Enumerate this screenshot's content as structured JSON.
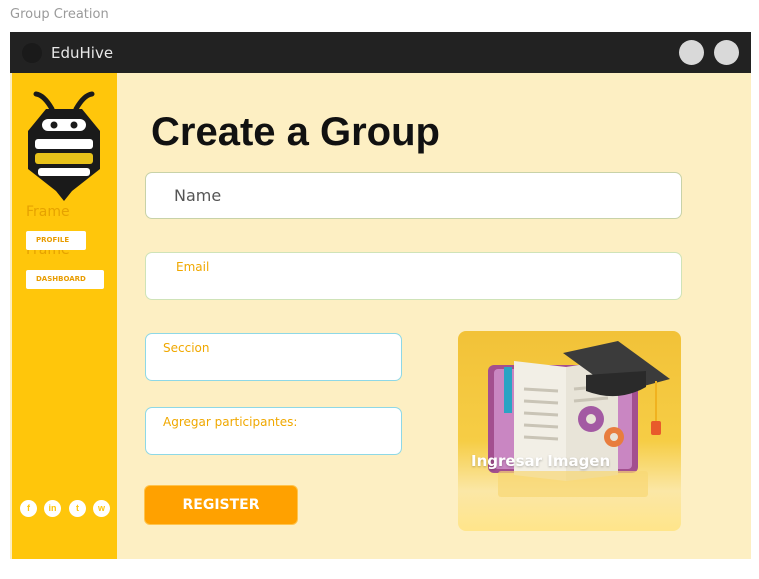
{
  "frame_label": "Group Creation",
  "app": {
    "title": "EduHive"
  },
  "sidebar": {
    "ghost_labels": [
      "Frame",
      "Frame"
    ],
    "items": [
      {
        "label": "PROFILE"
      },
      {
        "label": "DASHBOARD"
      }
    ],
    "social_icons": [
      "facebook-icon",
      "linkedin-icon",
      "twitter-icon",
      "whatsapp-icon"
    ]
  },
  "main": {
    "heading": "Create a Group",
    "fields": {
      "name": {
        "label": "Name"
      },
      "email": {
        "label": "Email"
      },
      "seccion": {
        "label": "Seccion"
      },
      "agregar": {
        "label": "Agregar participantes:"
      }
    },
    "register_label": "REGISTER",
    "image_card": {
      "label": "Ingresar Imagen"
    }
  },
  "colors": {
    "sidebar": "#ffc60b",
    "background": "#fdefc3",
    "accent": "#ffa100",
    "titlebar": "#222222"
  }
}
